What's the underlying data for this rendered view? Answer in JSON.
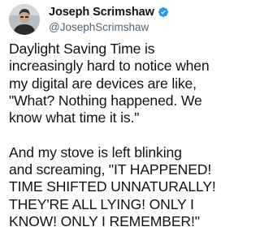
{
  "author": {
    "display_name": "Joseph Scrimshaw",
    "handle": "@JosephScrimshaw",
    "verified": true,
    "verified_color": "#1d9bf0",
    "avatar_icon": "profile-photo"
  },
  "tweet": {
    "text": "Daylight Saving Time is\nincreasingly hard to notice when\nmy digital are devices are like,\n\"What? Nothing happened. We\nknow what time it is.\"\n\nAnd my stove is left blinking\nand screaming, \"IT HAPPENED!\nTIME SHIFTED UNNATURALLY!\nTHEY'RE ALL LYING! ONLY I\nKNOW! ONLY I REMEMBER!\""
  }
}
